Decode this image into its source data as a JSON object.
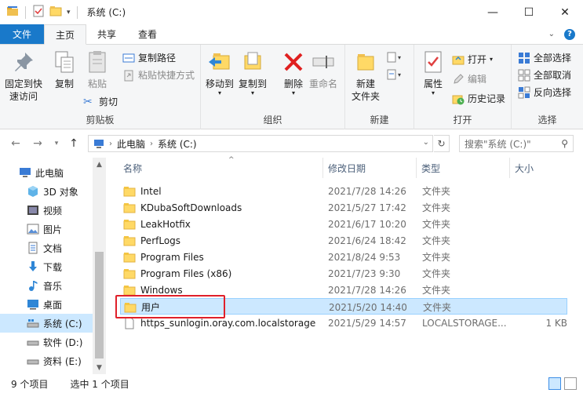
{
  "window": {
    "title": "系统 (C:)",
    "controls": [
      "—",
      "☐",
      "✕"
    ]
  },
  "tabs": {
    "file": "文件",
    "home": "主页",
    "share": "共享",
    "view": "查看"
  },
  "ribbon": {
    "clipboard": {
      "label": "剪贴板",
      "pin": "固定到快速访问",
      "pin_line1": "固定到快",
      "pin_line2": "速访问",
      "copy": "复制",
      "paste": "粘贴",
      "copy_path": "复制路径",
      "paste_shortcut": "粘贴快捷方式",
      "cut": "剪切"
    },
    "organize": {
      "label": "组织",
      "move_to": "移动到",
      "copy_to": "复制到",
      "delete": "删除",
      "rename": "重命名"
    },
    "new": {
      "label": "新建",
      "new_folder_line1": "新建",
      "new_folder_line2": "文件夹"
    },
    "open": {
      "label": "打开",
      "properties": "属性",
      "open": "打开",
      "edit": "编辑",
      "history": "历史记录"
    },
    "select": {
      "label": "选择",
      "select_all": "全部选择",
      "select_none": "全部取消",
      "invert": "反向选择"
    }
  },
  "address": {
    "crumbs": [
      "此电脑",
      "系统 (C:)"
    ],
    "search_placeholder": "搜索\"系统 (C:)\""
  },
  "nav_pane": {
    "items": [
      {
        "label": "此电脑",
        "icon": "computer-icon"
      },
      {
        "label": "3D 对象",
        "icon": "3d-objects-icon"
      },
      {
        "label": "视频",
        "icon": "video-icon"
      },
      {
        "label": "图片",
        "icon": "pictures-icon"
      },
      {
        "label": "文档",
        "icon": "documents-icon"
      },
      {
        "label": "下载",
        "icon": "download-icon"
      },
      {
        "label": "音乐",
        "icon": "music-icon"
      },
      {
        "label": "桌面",
        "icon": "desktop-icon"
      },
      {
        "label": "系统 (C:)",
        "icon": "drive-icon",
        "selected": true
      },
      {
        "label": "软件 (D:)",
        "icon": "drive-icon"
      },
      {
        "label": "资料 (E:)",
        "icon": "drive-icon"
      }
    ]
  },
  "file_list": {
    "columns": {
      "name": "名称",
      "date": "修改日期",
      "type": "类型",
      "size": "大小"
    },
    "rows": [
      {
        "name": "Intel",
        "date": "2021/7/28 14:26",
        "type": "文件夹",
        "size": "",
        "kind": "folder"
      },
      {
        "name": "KDubaSoftDownloads",
        "date": "2021/5/27 17:42",
        "type": "文件夹",
        "size": "",
        "kind": "folder"
      },
      {
        "name": "LeakHotfix",
        "date": "2021/6/17 10:20",
        "type": "文件夹",
        "size": "",
        "kind": "folder"
      },
      {
        "name": "PerfLogs",
        "date": "2021/6/24 18:42",
        "type": "文件夹",
        "size": "",
        "kind": "folder"
      },
      {
        "name": "Program Files",
        "date": "2021/8/24 9:53",
        "type": "文件夹",
        "size": "",
        "kind": "folder"
      },
      {
        "name": "Program Files (x86)",
        "date": "2021/7/23 9:30",
        "type": "文件夹",
        "size": "",
        "kind": "folder"
      },
      {
        "name": "Windows",
        "date": "2021/7/28 14:26",
        "type": "文件夹",
        "size": "",
        "kind": "folder"
      },
      {
        "name": "用户",
        "date": "2021/5/20 14:40",
        "type": "文件夹",
        "size": "",
        "kind": "folder",
        "selected": true
      },
      {
        "name": "https_sunlogin.oray.com.localstorage",
        "date": "2021/5/29 14:57",
        "type": "LOCALSTORAGE...",
        "size": "1 KB",
        "kind": "file"
      }
    ]
  },
  "status": {
    "count": "9 个项目",
    "selection": "选中 1 个项目"
  },
  "colors": {
    "accent": "#1979ca",
    "selection": "#cce8ff",
    "highlight_box": "#e0202a",
    "folder": "#ffd966"
  }
}
